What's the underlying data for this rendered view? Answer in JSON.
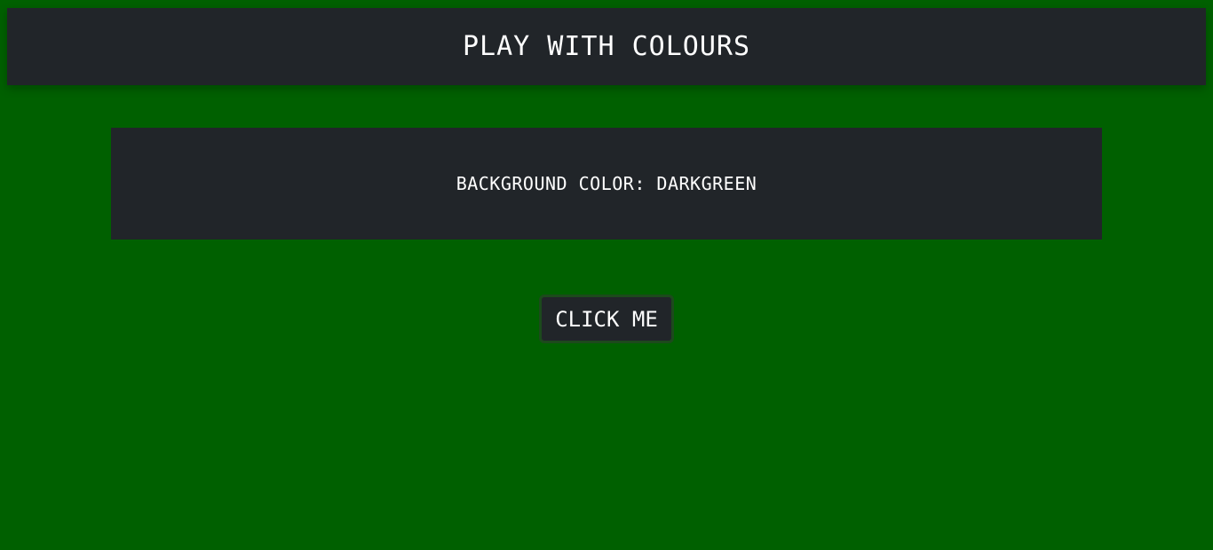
{
  "page": {
    "background_color": "#006000"
  },
  "header": {
    "title": "PLAY WITH COLOURS"
  },
  "panel": {
    "text": "BACKGROUND COLOR: DARKGREEN"
  },
  "button": {
    "label": "CLICK ME"
  },
  "colors": {
    "surface": "#212529",
    "text": "#ffffff",
    "button_border": "#1c4a1c"
  }
}
